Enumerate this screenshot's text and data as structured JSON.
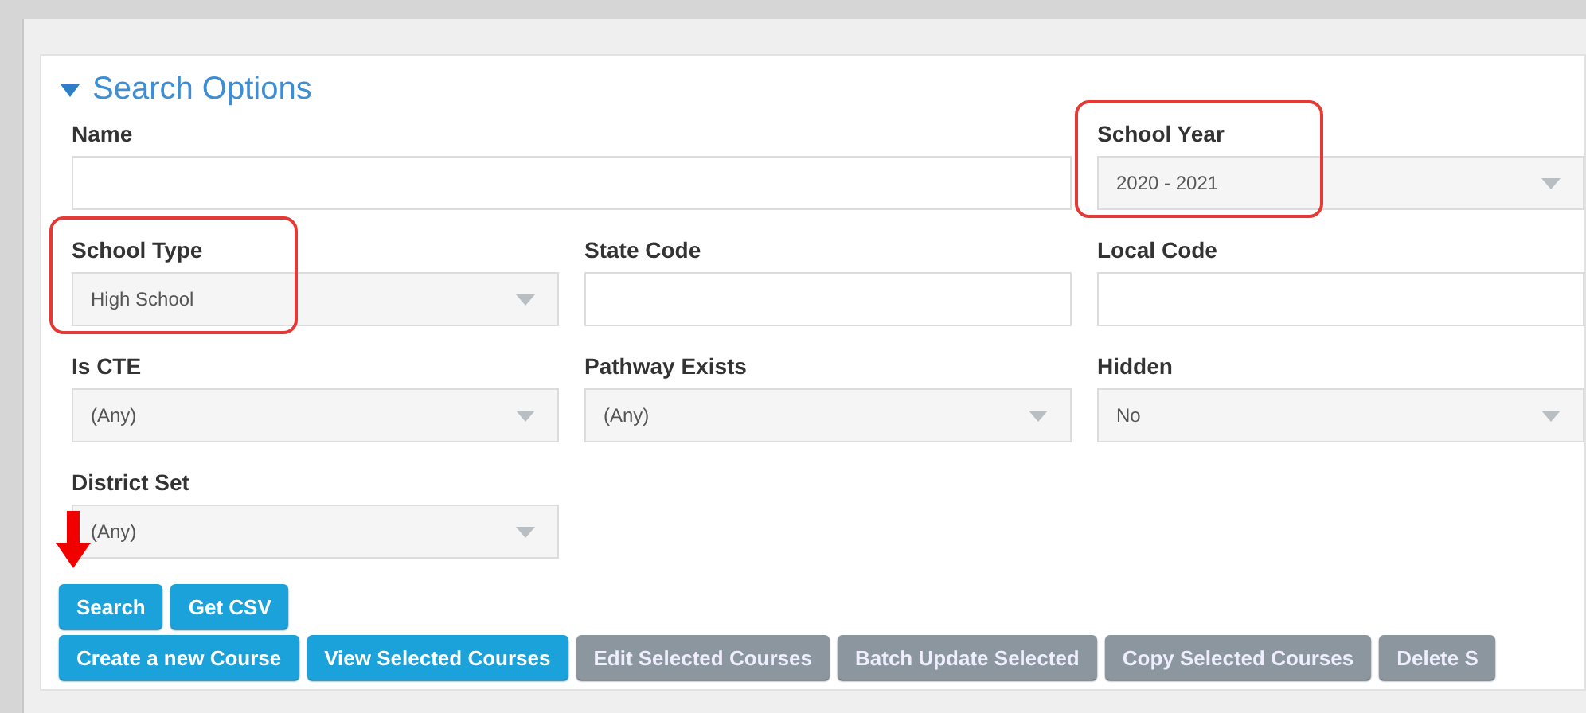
{
  "section": {
    "title": "Search Options",
    "expanded": true
  },
  "rows": [
    [
      {
        "label": "Name",
        "kind": "text",
        "highlighted": false
      },
      {
        "label": "School Year",
        "kind": "select",
        "value": "2020 - 2021",
        "highlighted": true
      }
    ],
    [
      {
        "label": "School Type",
        "kind": "select",
        "value": "High School",
        "highlighted": true
      },
      {
        "label": "State Code",
        "kind": "text",
        "highlighted": false
      },
      {
        "label": "Local Code",
        "kind": "text",
        "highlighted": false
      }
    ],
    [
      {
        "label": "Is CTE",
        "kind": "select",
        "value": "(Any)",
        "highlighted": false
      },
      {
        "label": "Pathway Exists",
        "kind": "select",
        "value": "(Any)",
        "highlighted": false
      },
      {
        "label": "Hidden",
        "kind": "select",
        "value": "No",
        "highlighted": false
      }
    ],
    [
      {
        "label": "District Set",
        "kind": "select",
        "value": "(Any)",
        "highlighted": false
      }
    ]
  ],
  "button_rows": [
    [
      {
        "label": "Search",
        "disabled": false,
        "pointed": true
      },
      {
        "label": "Get CSV",
        "disabled": false,
        "pointed": false
      }
    ],
    [
      {
        "label": "Create a new Course",
        "disabled": false,
        "pointed": false
      },
      {
        "label": "View Selected Courses",
        "disabled": false,
        "pointed": false
      },
      {
        "label": "Edit Selected Courses",
        "disabled": true,
        "pointed": false
      },
      {
        "label": "Batch Update Selected",
        "disabled": true,
        "pointed": false
      },
      {
        "label": "Copy Selected Courses",
        "disabled": true,
        "pointed": false
      },
      {
        "label": "Delete S",
        "disabled": true,
        "pointed": false
      }
    ]
  ]
}
